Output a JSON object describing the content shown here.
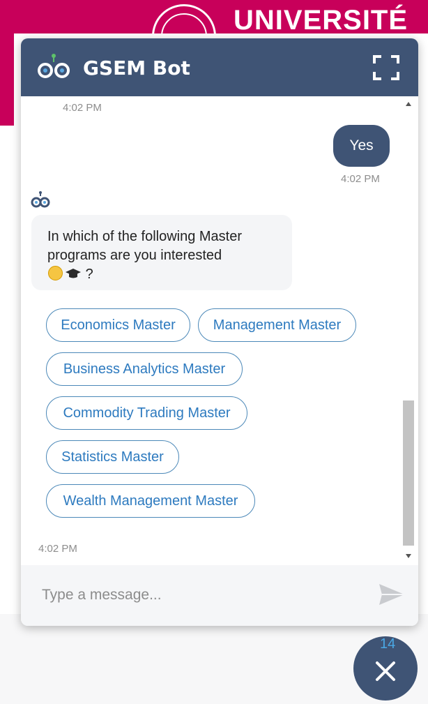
{
  "background": {
    "site_title": "UNIVERSITÉ",
    "brand_color": "#c8005a"
  },
  "header": {
    "title": "GSEM Bot",
    "logo_icon": "bot-logo-icon",
    "expand_icon": "fullscreen-icon",
    "color": "#3f5475"
  },
  "messages": [
    {
      "type": "timestamp",
      "time": "4:02 PM"
    },
    {
      "type": "user",
      "text": "Yes",
      "time": "4:02 PM"
    },
    {
      "type": "bot",
      "text": "In which of the following Master programs are you interested",
      "emoji_suffix": "?",
      "emoji_icons": [
        "smiling-face-icon",
        "graduation-cap-icon"
      ],
      "options": [
        "Economics Master",
        "Management Master",
        "Business Analytics Master",
        "Commodity Trading Master",
        "Statistics Master",
        "Wealth Management Master"
      ],
      "time": "4:02 PM"
    }
  ],
  "input": {
    "placeholder": "Type a message...",
    "send_icon": "send-icon"
  },
  "launcher": {
    "badge": "14",
    "icon": "close-icon"
  }
}
